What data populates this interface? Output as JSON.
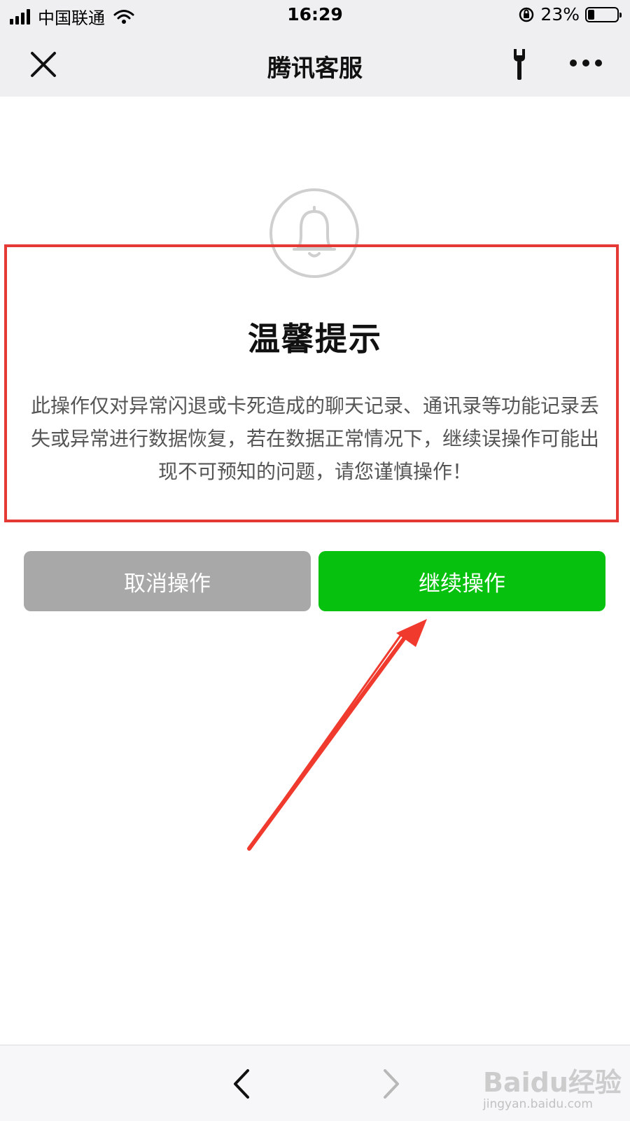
{
  "status_bar": {
    "carrier": "中国联通",
    "time": "16:29",
    "battery_percent": "23%",
    "battery_level": 0.23,
    "icons": [
      "signal-icon",
      "wifi-icon",
      "rotation-lock-icon",
      "battery-icon"
    ]
  },
  "nav": {
    "title": "腾讯客服",
    "icons": [
      "close-icon",
      "wrench-icon",
      "more-icon"
    ]
  },
  "dialog": {
    "icon": "bell-icon",
    "title": "温馨提示",
    "body": "此操作仅对异常闪退或卡死造成的聊天记录、通讯录等功能记录丢失或异常进行数据恢复，若在数据正常情况下，继续误操作可能出现不可预知的问题，请您谨慎操作！",
    "cancel_label": "取消操作",
    "continue_label": "继续操作"
  },
  "colors": {
    "nav_bg": "#efeff1",
    "cancel_btn": "#a8a8a8",
    "continue_btn": "#07c10f",
    "annotation_red": "#e53935"
  },
  "bottom_bar": {
    "icons": [
      "back-chevron-icon",
      "forward-chevron-icon"
    ]
  },
  "watermark": {
    "main": "Baidu经验",
    "url": "jingyan.baidu.com"
  }
}
